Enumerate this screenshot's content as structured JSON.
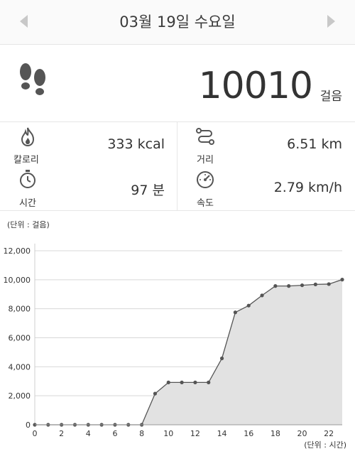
{
  "header": {
    "date": "03월 19일 수요일"
  },
  "steps": {
    "value": "10010",
    "unit": "걸음"
  },
  "stats": {
    "calories": {
      "label": "칼로리",
      "value": "333 kcal"
    },
    "distance": {
      "label": "거리",
      "value": "6.51 km"
    },
    "time": {
      "label": "시간",
      "value": "97 분"
    },
    "speed": {
      "label": "속도",
      "value": "2.79 km/h"
    }
  },
  "chart_data": {
    "type": "area",
    "y_unit_label": "(단위 : 걸음)",
    "x_unit_label": "(단위 : 시간)",
    "x": [
      0,
      1,
      2,
      3,
      4,
      5,
      6,
      7,
      8,
      9,
      10,
      11,
      12,
      13,
      14,
      15,
      16,
      17,
      18,
      19,
      20,
      21,
      22,
      23
    ],
    "values": [
      0,
      0,
      0,
      0,
      0,
      0,
      0,
      0,
      0,
      2150,
      2920,
      2920,
      2920,
      2920,
      4580,
      7750,
      8220,
      8920,
      9570,
      9570,
      9620,
      9680,
      9700,
      10010
    ],
    "xlim": [
      0,
      23
    ],
    "ylim": [
      0,
      12000
    ],
    "x_ticks": [
      0,
      2,
      4,
      6,
      8,
      10,
      12,
      14,
      16,
      18,
      20,
      22
    ],
    "y_ticks": [
      "0",
      "2,000",
      "4,000",
      "6,000",
      "8,000",
      "10,000",
      "12,000"
    ],
    "grid": true,
    "colors": {
      "fill": "#e2e2e2",
      "line": "#555555",
      "point": "#555555"
    }
  }
}
